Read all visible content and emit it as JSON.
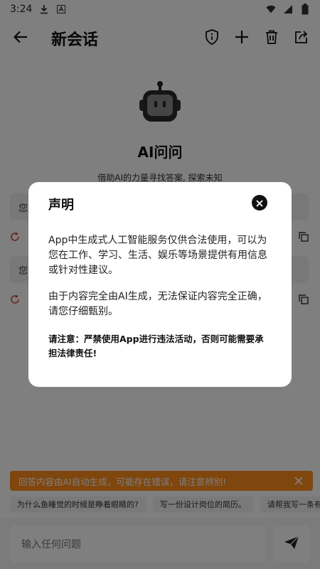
{
  "status_bar": {
    "time": "3:24",
    "icons": [
      "download-icon",
      "a-icon",
      "wifi-icon",
      "signal-icon",
      "battery-icon"
    ]
  },
  "app_bar": {
    "title": "新会话",
    "actions": [
      "shield-info-icon",
      "plus-icon",
      "trash-icon",
      "share-icon"
    ]
  },
  "assistant": {
    "name": "AI问问",
    "description": "借助AI的力量寻找答案, 探索未知"
  },
  "chat": {
    "messages": [
      "您好",
      "您"
    ]
  },
  "notice": {
    "text": "回答内容由AI自动生成，可能存在错误，请注意辨别!",
    "bg_color": "#ff8c1a"
  },
  "suggestions": [
    "为什么鱼睡觉的时候是睁着眼睛的?",
    "写一份设计岗位的简历。",
    "请帮我写一条有关毕业求"
  ],
  "input": {
    "placeholder": "输入任何问题"
  },
  "dialog": {
    "title": "声明",
    "p1": "App中生成式人工智能服务仅供合法使用，可以为您在工作、学习、生活、娱乐等场景提供有用信息或针对性建议。",
    "p2": "由于内容完全由AI生成，无法保证内容完全正确，请您仔细甄别。",
    "warning": "请注意：严禁使用App进行违法活动，否则可能需要承担法律责任!"
  }
}
